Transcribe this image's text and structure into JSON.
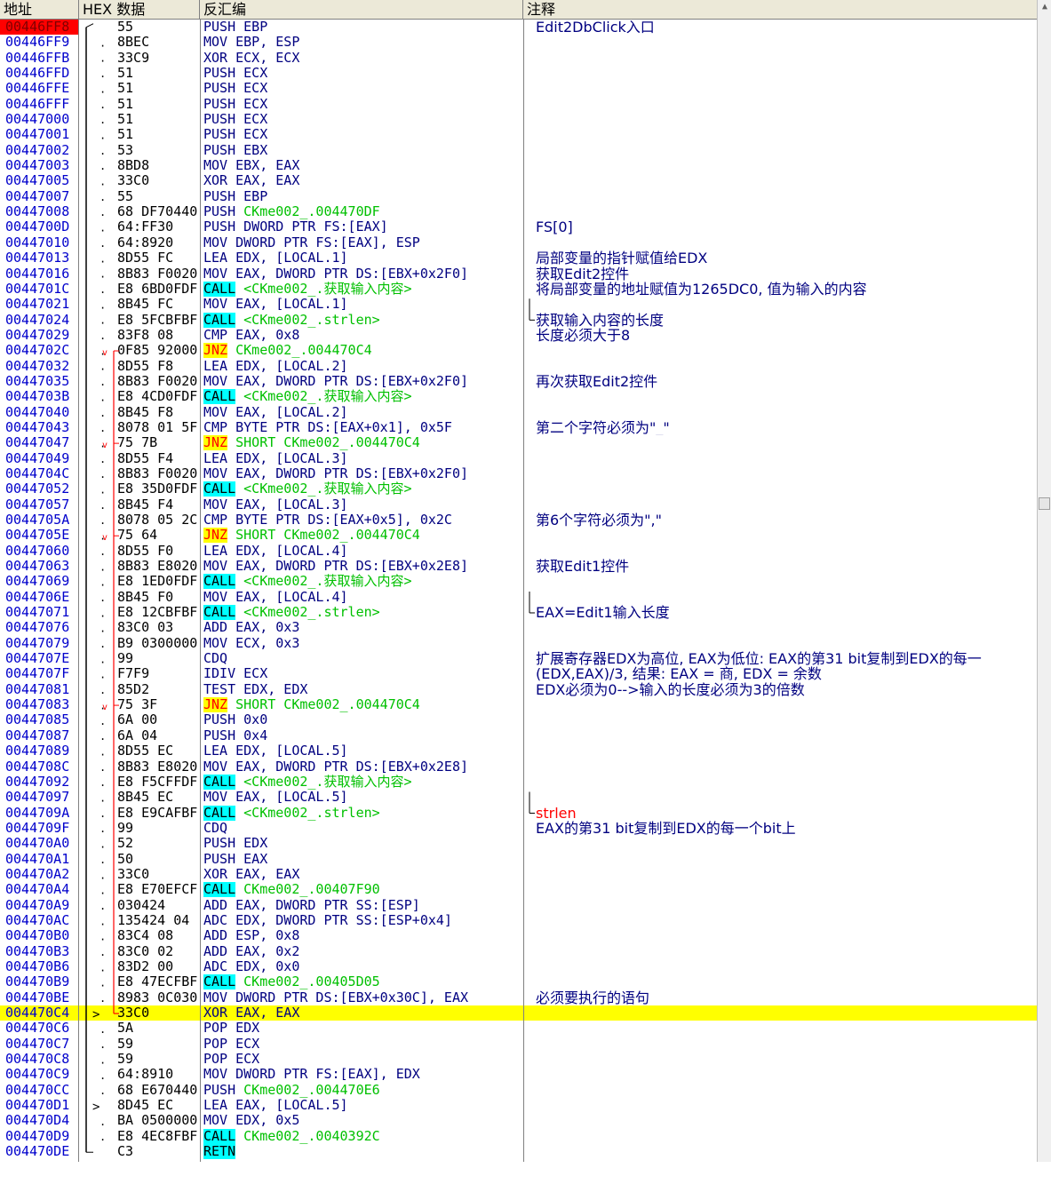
{
  "columns": {
    "address": "地址",
    "hex": "HEX 数据",
    "disasm": "反汇编",
    "comment": "注释"
  },
  "rows": [
    {
      "addr": "00446FF8",
      "hex": "55",
      "mn": "PUSH",
      "op": "EBP",
      "comment": "Edit2DbClick入口"
    },
    {
      "addr": "00446FF9",
      "hex": "8BEC",
      "mn": "MOV",
      "op": "EBP, ESP"
    },
    {
      "addr": "00446FFB",
      "hex": "33C9",
      "mn": "XOR",
      "op": "ECX, ECX"
    },
    {
      "addr": "00446FFD",
      "hex": "51",
      "mn": "PUSH",
      "op": "ECX"
    },
    {
      "addr": "00446FFE",
      "hex": "51",
      "mn": "PUSH",
      "op": "ECX"
    },
    {
      "addr": "00446FFF",
      "hex": "51",
      "mn": "PUSH",
      "op": "ECX"
    },
    {
      "addr": "00447000",
      "hex": "51",
      "mn": "PUSH",
      "op": "ECX"
    },
    {
      "addr": "00447001",
      "hex": "51",
      "mn": "PUSH",
      "op": "ECX"
    },
    {
      "addr": "00447002",
      "hex": "53",
      "mn": "PUSH",
      "op": "EBX"
    },
    {
      "addr": "00447003",
      "hex": "8BD8",
      "mn": "MOV",
      "op": "EBX, EAX"
    },
    {
      "addr": "00447005",
      "hex": "33C0",
      "mn": "XOR",
      "op": "EAX, EAX"
    },
    {
      "addr": "00447007",
      "hex": "55",
      "mn": "PUSH",
      "op": "EBP"
    },
    {
      "addr": "00447008",
      "hex": "68 DF70440",
      "mn": "PUSH",
      "op": "CKme002_.004470DF",
      "green": true
    },
    {
      "addr": "0044700D",
      "hex": "64:FF30",
      "mn": "PUSH",
      "op": "DWORD PTR FS:[EAX]",
      "comment": "FS[0]"
    },
    {
      "addr": "00447010",
      "hex": "64:8920",
      "mn": "MOV",
      "op": "DWORD PTR FS:[EAX], ESP"
    },
    {
      "addr": "00447013",
      "hex": "8D55 FC",
      "mn": "LEA",
      "op": "EDX, [LOCAL.1]",
      "comment": "局部变量的指针赋值给EDX"
    },
    {
      "addr": "00447016",
      "hex": "8B83 F0020",
      "mn": "MOV",
      "op": "EAX, DWORD PTR DS:[EBX+0x2F0]",
      "comment": "获取Edit2控件"
    },
    {
      "addr": "0044701C",
      "hex": "E8 6BD0FDF",
      "mn": "CALL",
      "op": "<CKme002_.获取输入内容>",
      "green": true,
      "comment": "将局部变量的地址赋值为1265DC0, 值为输入的内容"
    },
    {
      "addr": "00447021",
      "hex": "8B45 FC",
      "mn": "MOV",
      "op": "EAX, [LOCAL.1]"
    },
    {
      "addr": "00447024",
      "hex": "E8 5FCBFBF",
      "mn": "CALL",
      "op": "<CKme002_.strlen>",
      "green": true,
      "comment": "获取输入内容的长度"
    },
    {
      "addr": "00447029",
      "hex": "83F8 08",
      "mn": "CMP",
      "op": "EAX, 0x8",
      "comment": "长度必须大于8"
    },
    {
      "addr": "0044702C",
      "hex": "0F85 92000",
      "mn": "JNZ",
      "op": "CKme002_.004470C4",
      "green": true
    },
    {
      "addr": "00447032",
      "hex": "8D55 F8",
      "mn": "LEA",
      "op": "EDX, [LOCAL.2]"
    },
    {
      "addr": "00447035",
      "hex": "8B83 F0020",
      "mn": "MOV",
      "op": "EAX, DWORD PTR DS:[EBX+0x2F0]",
      "comment": "再次获取Edit2控件"
    },
    {
      "addr": "0044703B",
      "hex": "E8 4CD0FDF",
      "mn": "CALL",
      "op": "<CKme002_.获取输入内容>",
      "green": true
    },
    {
      "addr": "00447040",
      "hex": "8B45 F8",
      "mn": "MOV",
      "op": "EAX, [LOCAL.2]"
    },
    {
      "addr": "00447043",
      "hex": "8078 01 5F",
      "mn": "CMP",
      "op": "BYTE PTR DS:[EAX+0x1], 0x5F",
      "comment": "第二个字符必须为\"_\""
    },
    {
      "addr": "00447047",
      "hex": "75 7B",
      "mn": "JNZ",
      "op": "SHORT CKme002_.004470C4",
      "green": true
    },
    {
      "addr": "00447049",
      "hex": "8D55 F4",
      "mn": "LEA",
      "op": "EDX, [LOCAL.3]"
    },
    {
      "addr": "0044704C",
      "hex": "8B83 F0020",
      "mn": "MOV",
      "op": "EAX, DWORD PTR DS:[EBX+0x2F0]"
    },
    {
      "addr": "00447052",
      "hex": "E8 35D0FDF",
      "mn": "CALL",
      "op": "<CKme002_.获取输入内容>",
      "green": true
    },
    {
      "addr": "00447057",
      "hex": "8B45 F4",
      "mn": "MOV",
      "op": "EAX, [LOCAL.3]"
    },
    {
      "addr": "0044705A",
      "hex": "8078 05 2C",
      "mn": "CMP",
      "op": "BYTE PTR DS:[EAX+0x5], 0x2C",
      "comment": "第6个字符必须为\",\""
    },
    {
      "addr": "0044705E",
      "hex": "75 64",
      "mn": "JNZ",
      "op": "SHORT CKme002_.004470C4",
      "green": true
    },
    {
      "addr": "00447060",
      "hex": "8D55 F0",
      "mn": "LEA",
      "op": "EDX, [LOCAL.4]"
    },
    {
      "addr": "00447063",
      "hex": "8B83 E8020",
      "mn": "MOV",
      "op": "EAX, DWORD PTR DS:[EBX+0x2E8]",
      "comment": "获取Edit1控件"
    },
    {
      "addr": "00447069",
      "hex": "E8 1ED0FDF",
      "mn": "CALL",
      "op": "<CKme002_.获取输入内容>",
      "green": true
    },
    {
      "addr": "0044706E",
      "hex": "8B45 F0",
      "mn": "MOV",
      "op": "EAX, [LOCAL.4]"
    },
    {
      "addr": "00447071",
      "hex": "E8 12CBFBF",
      "mn": "CALL",
      "op": "<CKme002_.strlen>",
      "green": true,
      "comment": "EAX=Edit1输入长度"
    },
    {
      "addr": "00447076",
      "hex": "83C0 03",
      "mn": "ADD",
      "op": "EAX, 0x3"
    },
    {
      "addr": "00447079",
      "hex": "B9 0300000",
      "mn": "MOV",
      "op": "ECX, 0x3"
    },
    {
      "addr": "0044707E",
      "hex": "99",
      "mn": "CDQ",
      "op": "",
      "comment": "扩展寄存器EDX为高位, EAX为低位: EAX的第31 bit复制到EDX的每一"
    },
    {
      "addr": "0044707F",
      "hex": "F7F9",
      "mn": "IDIV",
      "op": "ECX",
      "comment": "(EDX,EAX)/3, 结果: EAX = 商, EDX = 余数"
    },
    {
      "addr": "00447081",
      "hex": "85D2",
      "mn": "TEST",
      "op": "EDX, EDX",
      "comment": "EDX必须为0-->输入的长度必须为3的倍数"
    },
    {
      "addr": "00447083",
      "hex": "75 3F",
      "mn": "JNZ",
      "op": "SHORT CKme002_.004470C4",
      "green": true
    },
    {
      "addr": "00447085",
      "hex": "6A 00",
      "mn": "PUSH",
      "op": "0x0"
    },
    {
      "addr": "00447087",
      "hex": "6A 04",
      "mn": "PUSH",
      "op": "0x4"
    },
    {
      "addr": "00447089",
      "hex": "8D55 EC",
      "mn": "LEA",
      "op": "EDX, [LOCAL.5]"
    },
    {
      "addr": "0044708C",
      "hex": "8B83 E8020",
      "mn": "MOV",
      "op": "EAX, DWORD PTR DS:[EBX+0x2E8]"
    },
    {
      "addr": "00447092",
      "hex": "E8 F5CFFDF",
      "mn": "CALL",
      "op": "<CKme002_.获取输入内容>",
      "green": true
    },
    {
      "addr": "00447097",
      "hex": "8B45 EC",
      "mn": "MOV",
      "op": "EAX, [LOCAL.5]"
    },
    {
      "addr": "0044709A",
      "hex": "E8 E9CAFBF",
      "mn": "CALL",
      "op": "<CKme002_.strlen>",
      "green": true,
      "comment": "strlen",
      "comment_red": true
    },
    {
      "addr": "0044709F",
      "hex": "99",
      "mn": "CDQ",
      "op": "",
      "comment": "EAX的第31 bit复制到EDX的每一个bit上"
    },
    {
      "addr": "004470A0",
      "hex": "52",
      "mn": "PUSH",
      "op": "EDX"
    },
    {
      "addr": "004470A1",
      "hex": "50",
      "mn": "PUSH",
      "op": "EAX"
    },
    {
      "addr": "004470A2",
      "hex": "33C0",
      "mn": "XOR",
      "op": "EAX, EAX"
    },
    {
      "addr": "004470A4",
      "hex": "E8 E70EFCF",
      "mn": "CALL",
      "op": "CKme002_.00407F90",
      "green": true
    },
    {
      "addr": "004470A9",
      "hex": "030424",
      "mn": "ADD",
      "op": "EAX, DWORD PTR SS:[ESP]"
    },
    {
      "addr": "004470AC",
      "hex": "135424 04",
      "mn": "ADC",
      "op": "EDX, DWORD PTR SS:[ESP+0x4]"
    },
    {
      "addr": "004470B0",
      "hex": "83C4 08",
      "mn": "ADD",
      "op": "ESP, 0x8"
    },
    {
      "addr": "004470B3",
      "hex": "83C0 02",
      "mn": "ADD",
      "op": "EAX, 0x2"
    },
    {
      "addr": "004470B6",
      "hex": "83D2 00",
      "mn": "ADC",
      "op": "EDX, 0x0"
    },
    {
      "addr": "004470B9",
      "hex": "E8 47ECFBF",
      "mn": "CALL",
      "op": "CKme002_.00405D05",
      "green": true
    },
    {
      "addr": "004470BE",
      "hex": "8983 0C030",
      "mn": "MOV",
      "op": "DWORD PTR DS:[EBX+0x30C], EAX",
      "comment": "必须要执行的语句"
    },
    {
      "addr": "004470C4",
      "hex": "33C0",
      "mn": "XOR",
      "op": "EAX, EAX"
    },
    {
      "addr": "004470C6",
      "hex": "5A",
      "mn": "POP",
      "op": "EDX"
    },
    {
      "addr": "004470C7",
      "hex": "59",
      "mn": "POP",
      "op": "ECX"
    },
    {
      "addr": "004470C8",
      "hex": "59",
      "mn": "POP",
      "op": "ECX"
    },
    {
      "addr": "004470C9",
      "hex": "64:8910",
      "mn": "MOV",
      "op": "DWORD PTR FS:[EAX], EDX"
    },
    {
      "addr": "004470CC",
      "hex": "68 E670440",
      "mn": "PUSH",
      "op": "CKme002_.004470E6",
      "green": true
    },
    {
      "addr": "004470D1",
      "hex": "8D45 EC",
      "mn": "LEA",
      "op": "EAX, [LOCAL.5]"
    },
    {
      "addr": "004470D4",
      "hex": "BA 0500000",
      "mn": "MOV",
      "op": "EDX, 0x5"
    },
    {
      "addr": "004470D9",
      "hex": "E8 4EC8FBF",
      "mn": "CALL",
      "op": "CKme002_.0040392C",
      "green": true
    },
    {
      "addr": "004470DE",
      "hex": "C3",
      "mn": "RETN",
      "op": ""
    }
  ]
}
